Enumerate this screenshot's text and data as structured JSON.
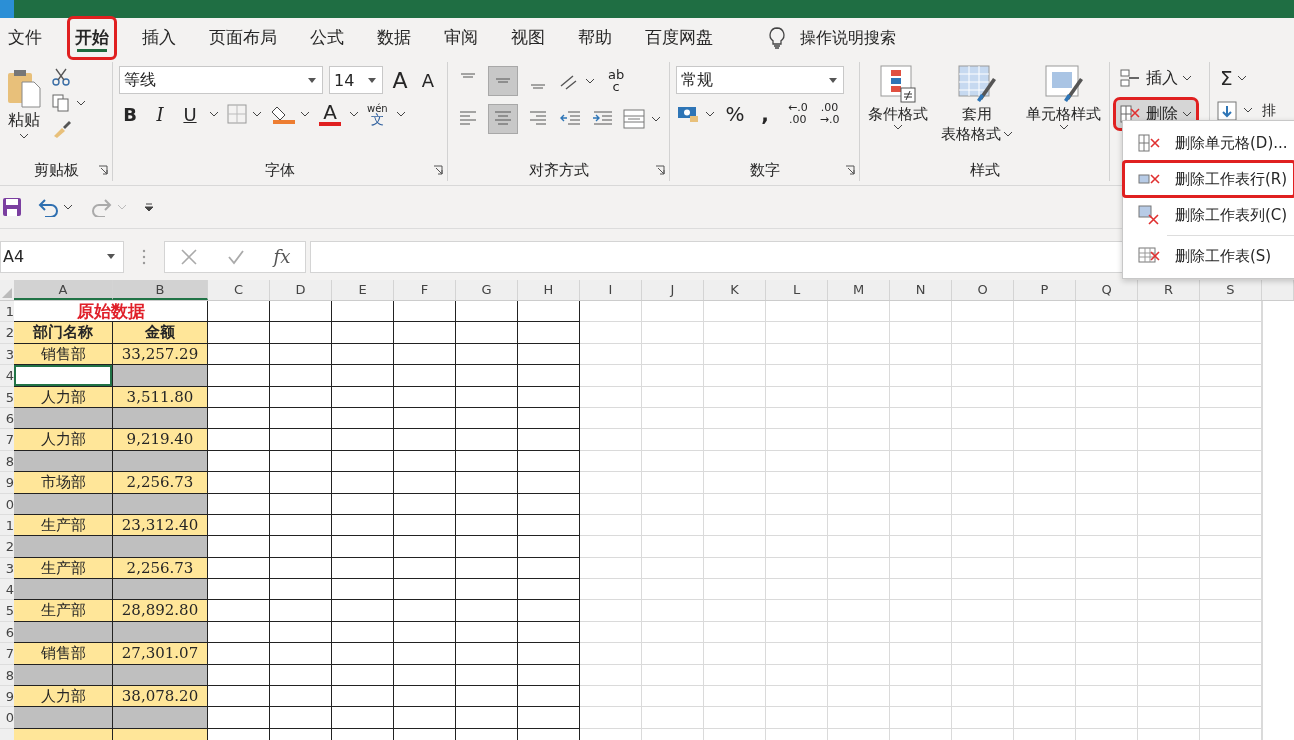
{
  "tabs": [
    {
      "label": "文件",
      "selected": false,
      "annotated": false
    },
    {
      "label": "开始",
      "selected": true,
      "annotated": true
    },
    {
      "label": "插入",
      "selected": false,
      "annotated": false
    },
    {
      "label": "页面布局",
      "selected": false,
      "annotated": false
    },
    {
      "label": "公式",
      "selected": false,
      "annotated": false
    },
    {
      "label": "数据",
      "selected": false,
      "annotated": false
    },
    {
      "label": "审阅",
      "selected": false,
      "annotated": false
    },
    {
      "label": "视图",
      "selected": false,
      "annotated": false
    },
    {
      "label": "帮助",
      "selected": false,
      "annotated": false
    },
    {
      "label": "百度网盘",
      "selected": false,
      "annotated": false
    }
  ],
  "tell_me": "操作说明搜索",
  "clipboard": {
    "paste": "粘贴",
    "group": "剪贴板"
  },
  "font": {
    "name": "等线",
    "size": "14",
    "grow": "A",
    "shrink": "A",
    "bold": "B",
    "italic": "I",
    "underline": "U",
    "font_color": "A",
    "phonetic_top": "wén",
    "phonetic_bottom": "文",
    "group": "字体"
  },
  "alignment": {
    "valign": [
      {
        "selected": false
      },
      {
        "selected": true
      },
      {
        "selected": false
      }
    ],
    "halign": [
      {
        "selected": false
      },
      {
        "selected": true
      },
      {
        "selected": false
      }
    ],
    "wrap_top": "ab",
    "wrap_bottom": "c",
    "group": "对齐方式"
  },
  "number": {
    "format": "常规",
    "percent": "%",
    "comma": ",",
    "increase_top": "←.0",
    "increase_bottom": ".00",
    "decrease_top": ".00",
    "decrease_bottom": "→.0",
    "group": "数字"
  },
  "styles": {
    "conditional": "条件格式",
    "table_line1": "套用",
    "table_line2": "表格格式",
    "cell": "单元格样式",
    "group": "样式"
  },
  "cells": {
    "insert": "插入",
    "delete": {
      "label": "删除",
      "annotated": true
    }
  },
  "editing": {
    "sum": "Σ",
    "cut_label": "排"
  },
  "name_box": "A4",
  "fx": "fx",
  "columns": [
    {
      "label": "A",
      "selected": true
    },
    {
      "label": "B",
      "selected": true
    },
    {
      "label": "C",
      "selected": false
    },
    {
      "label": "D",
      "selected": false
    },
    {
      "label": "E",
      "selected": false
    },
    {
      "label": "F",
      "selected": false
    },
    {
      "label": "G",
      "selected": false
    },
    {
      "label": "H",
      "selected": false
    },
    {
      "label": "I",
      "selected": false
    },
    {
      "label": "J",
      "selected": false
    },
    {
      "label": "K",
      "selected": false
    },
    {
      "label": "L",
      "selected": false
    },
    {
      "label": "M",
      "selected": false
    },
    {
      "label": "N",
      "selected": false
    },
    {
      "label": "O",
      "selected": false
    },
    {
      "label": "P",
      "selected": false
    },
    {
      "label": "Q",
      "selected": false
    },
    {
      "label": "R",
      "selected": false
    },
    {
      "label": "S",
      "selected": false
    }
  ],
  "rows": [
    {
      "number": "1",
      "kind": "title",
      "selected": false,
      "cells": [
        "原始数据"
      ]
    },
    {
      "number": "2",
      "kind": "header",
      "selected": false,
      "cells": [
        "部门名称",
        "金额"
      ]
    },
    {
      "number": "3",
      "kind": "data",
      "selected": false,
      "cells": [
        "销售部",
        "33,257.29"
      ]
    },
    {
      "number": "4",
      "kind": "blank",
      "selected": true,
      "cells": []
    },
    {
      "number": "5",
      "kind": "data",
      "selected": false,
      "cells": [
        "人力部",
        "3,511.80"
      ]
    },
    {
      "number": "6",
      "kind": "blank",
      "selected": false,
      "cells": []
    },
    {
      "number": "7",
      "kind": "data",
      "selected": false,
      "cells": [
        "人力部",
        "9,219.40"
      ]
    },
    {
      "number": "8",
      "kind": "blank",
      "selected": false,
      "cells": []
    },
    {
      "number": "9",
      "kind": "data",
      "selected": false,
      "cells": [
        "市场部",
        "2,256.73"
      ]
    },
    {
      "number": "0",
      "kind": "blank",
      "selected": false,
      "cells": []
    },
    {
      "number": "1",
      "kind": "data",
      "selected": false,
      "cells": [
        "生产部",
        "23,312.40"
      ]
    },
    {
      "number": "2",
      "kind": "blank",
      "selected": false,
      "cells": []
    },
    {
      "number": "3",
      "kind": "data",
      "selected": false,
      "cells": [
        "生产部",
        "2,256.73"
      ]
    },
    {
      "number": "4",
      "kind": "blank",
      "selected": false,
      "cells": []
    },
    {
      "number": "5",
      "kind": "data",
      "selected": false,
      "cells": [
        "生产部",
        "28,892.80"
      ]
    },
    {
      "number": "6",
      "kind": "blank",
      "selected": false,
      "cells": []
    },
    {
      "number": "7",
      "kind": "data",
      "selected": false,
      "cells": [
        "销售部",
        "27,301.07"
      ]
    },
    {
      "number": "8",
      "kind": "blank",
      "selected": false,
      "cells": []
    },
    {
      "number": "9",
      "kind": "data",
      "selected": false,
      "cells": [
        "人力部",
        "38,078.20"
      ]
    },
    {
      "number": "0",
      "kind": "blank",
      "selected": false,
      "cells": []
    }
  ],
  "menu": [
    {
      "label": "删除单元格(D)...",
      "annotated": false,
      "kind": "cells"
    },
    {
      "label": "删除工作表行(R)",
      "annotated": true,
      "kind": "rows"
    },
    {
      "label": "删除工作表列(C)",
      "annotated": false,
      "kind": "columns"
    },
    {
      "label": "删除工作表(S)",
      "annotated": false,
      "kind": "sheet"
    }
  ]
}
